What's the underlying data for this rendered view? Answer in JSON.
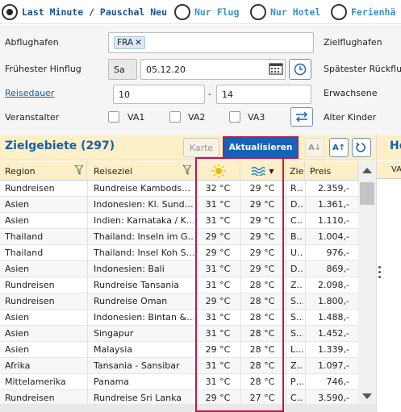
{
  "search_mode": {
    "options": [
      {
        "label": "Last Minute / Pauschal Neu",
        "checked": true
      },
      {
        "label": "Nur Flug",
        "checked": false
      },
      {
        "label": "Nur Hotel",
        "checked": false
      },
      {
        "label": "Ferienhä",
        "checked": false
      }
    ]
  },
  "form": {
    "abflughafen_label": "Abflughafen",
    "abflughafen_tag": "FRA",
    "zielflughafen_label": "Zielflughafen",
    "fruehester_hinflug_label": "Frühester Hinflug",
    "weekday": "Sa",
    "date": "05.12.20",
    "spaetester_rueckflug_label": "Spätester Rückflug",
    "reisedauer_label": "Reisedauer",
    "reisedauer_from": "10",
    "reisedauer_sep": "-",
    "reisedauer_to": "14",
    "erwachsene_label": "Erwachsene",
    "veranstalter_label": "Veranstalter",
    "va1": "VA1",
    "va2": "VA2",
    "va3": "VA3",
    "alter_kinder_label": "Alter Kinder"
  },
  "results": {
    "title": "Zielgebiete (297)",
    "karte_label": "Karte",
    "aktualisieren_label": "Aktualisieren",
    "right_panel_title": "Ho",
    "right_panel_col": "VA"
  },
  "table": {
    "headers": {
      "region": "Region",
      "reiseziel": "Reiseziel",
      "code": "Zie",
      "preis": "Preis"
    },
    "rows": [
      {
        "region": "Rundreisen",
        "reiseziel": "Rundreise Kambods…",
        "luft": "32 °C",
        "wasser": "29 °C",
        "code": "R…",
        "preis": "2.359,-"
      },
      {
        "region": "Asien",
        "reiseziel": "Indonesien: Kl. Sund…",
        "luft": "31 °C",
        "wasser": "29 °C",
        "code": "D…",
        "preis": "1.361,-"
      },
      {
        "region": "Asien",
        "reiseziel": "Indien: Karnataka / K…",
        "luft": "31 °C",
        "wasser": "29 °C",
        "code": "C…",
        "preis": "1.110,-"
      },
      {
        "region": "Thailand",
        "reiseziel": "Thailand: Inseln im G…",
        "luft": "29 °C",
        "wasser": "29 °C",
        "code": "B…",
        "preis": "1.004,-"
      },
      {
        "region": "Thailand",
        "reiseziel": "Thailand: Insel Koh S…",
        "luft": "29 °C",
        "wasser": "29 °C",
        "code": "U…",
        "preis": "976,-"
      },
      {
        "region": "Asien",
        "reiseziel": "Indonesien: Bali",
        "luft": "31 °C",
        "wasser": "29 °C",
        "code": "D…",
        "preis": "869,-"
      },
      {
        "region": "Rundreisen",
        "reiseziel": "Rundreise Tansania",
        "luft": "31 °C",
        "wasser": "28 °C",
        "code": "Z…",
        "preis": "2.098,-"
      },
      {
        "region": "Rundreisen",
        "reiseziel": "Rundreise Oman",
        "luft": "29 °C",
        "wasser": "28 °C",
        "code": "S…",
        "preis": "1.800,-"
      },
      {
        "region": "Asien",
        "reiseziel": "Indonesien: Bintan &…",
        "luft": "31 °C",
        "wasser": "28 °C",
        "code": "S…",
        "preis": "1.488,-"
      },
      {
        "region": "Asien",
        "reiseziel": "Singapur",
        "luft": "31 °C",
        "wasser": "28 °C",
        "code": "S…",
        "preis": "1.452,-"
      },
      {
        "region": "Asien",
        "reiseziel": "Malaysia",
        "luft": "29 °C",
        "wasser": "28 °C",
        "code": "L…",
        "preis": "1.339,-"
      },
      {
        "region": "Afrika",
        "reiseziel": "Tansania - Sansibar",
        "luft": "31 °C",
        "wasser": "28 °C",
        "code": "Z…",
        "preis": "1.097,-"
      },
      {
        "region": "Mittelamerika",
        "reiseziel": "Panama",
        "luft": "31 °C",
        "wasser": "28 °C",
        "code": "P…",
        "preis": "746,-"
      },
      {
        "region": "Rundreisen",
        "reiseziel": "Rundreise Sri Lanka",
        "luft": "29 °C",
        "wasser": "27 °C",
        "code": "C…",
        "preis": "3.590,-"
      }
    ]
  },
  "colors": {
    "accent": "#1662b8",
    "highlight": "#c0174f",
    "header_bg": "#fdf0c8",
    "link": "#1a5ea8"
  },
  "icons": [
    "calendar-icon",
    "clock-icon",
    "swap-icon",
    "filter-icon",
    "sun-icon",
    "waves-icon",
    "sort-icon",
    "refresh-icon"
  ]
}
